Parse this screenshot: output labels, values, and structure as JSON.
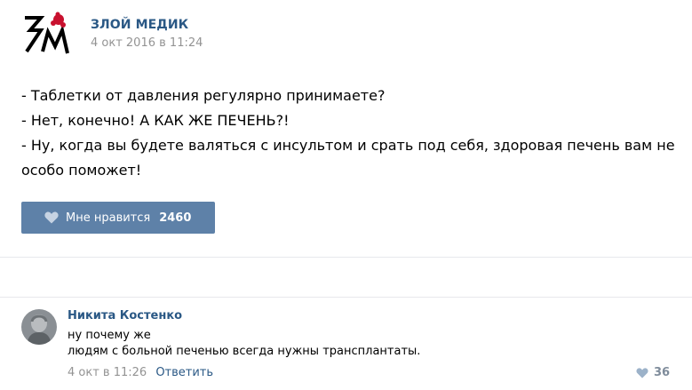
{
  "post": {
    "group_name": "ЗЛОЙ МЕДИК",
    "date": "4 окт 2016 в 11:24",
    "logo_letters": "ЗМ",
    "lines": [
      "- Таблетки от давления регулярно принимаете?",
      "- Нет, конечно! А КАК ЖЕ ПЕЧЕНЬ?!",
      "- Ну, когда вы будете валяться с инсультом и срать под себя, здоровая печень вам не",
      "особо поможет!"
    ],
    "like_label": "Мне нравится",
    "like_count": "2460",
    "like_icon": "heart-icon"
  },
  "comment": {
    "author": "Никита Костенко",
    "lines": [
      "ну почему же",
      "людям с больной печенью всегда нужны трансплантаты."
    ],
    "date": "4 окт в 11:26",
    "reply_label": "Ответить",
    "like_count": "36",
    "like_icon": "heart-icon"
  },
  "colors": {
    "link": "#2a5885",
    "like_button": "#5e81a8",
    "meta": "#939393",
    "divider": "#e7e8ec",
    "logo_red": "#c8102e"
  }
}
